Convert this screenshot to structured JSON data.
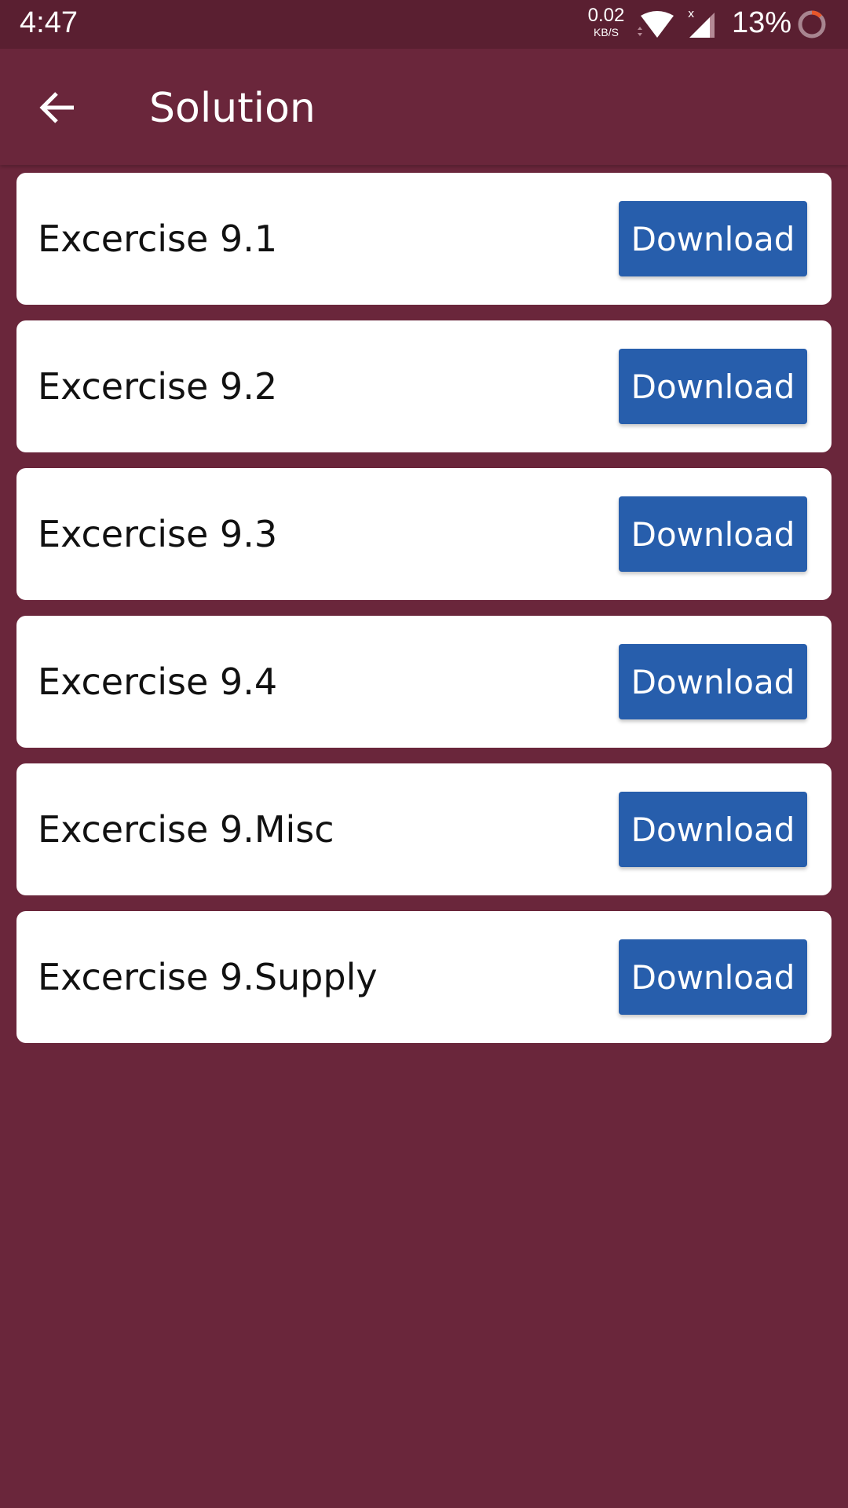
{
  "status_bar": {
    "time": "4:47",
    "net_speed_value": "0.02",
    "net_speed_unit": "KB/S",
    "signal_badge": "x",
    "battery_percent": "13%",
    "battery_accent": "#e8572a"
  },
  "app_bar": {
    "back_icon": "arrow-left-icon",
    "title": "Solution",
    "background": "#6a263b"
  },
  "colors": {
    "background": "#6a263b",
    "status_bar": "#5a1f31",
    "button": "#275eac",
    "card": "#ffffff"
  },
  "items": [
    {
      "label": "Excercise 9.1",
      "button": "Download"
    },
    {
      "label": "Excercise 9.2",
      "button": "Download"
    },
    {
      "label": "Excercise 9.3",
      "button": "Download"
    },
    {
      "label": "Excercise 9.4",
      "button": "Download"
    },
    {
      "label": "Excercise 9.Misc",
      "button": "Download"
    },
    {
      "label": "Excercise 9.Supply",
      "button": "Download"
    }
  ]
}
